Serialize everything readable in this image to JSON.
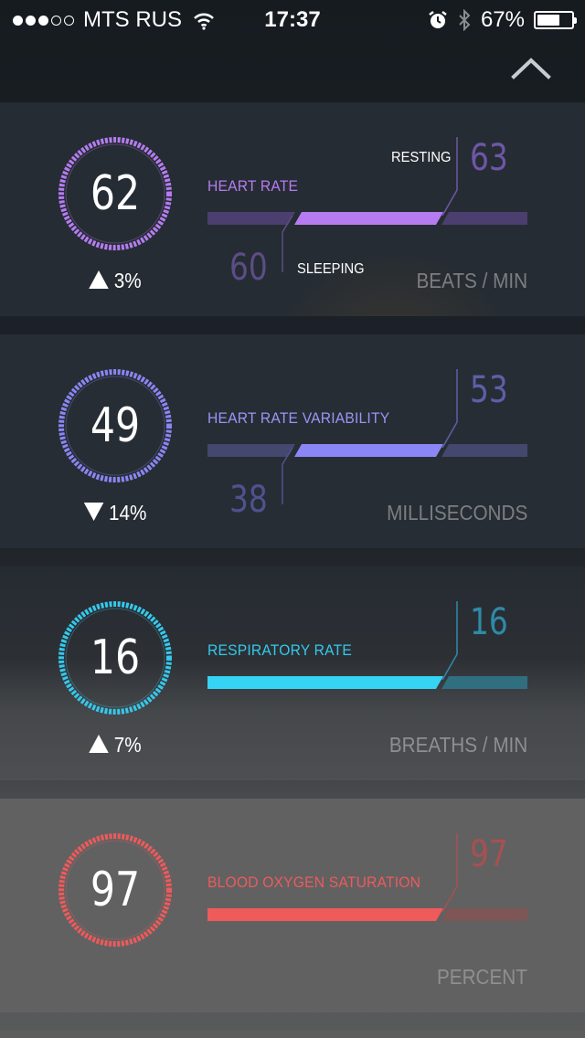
{
  "status_bar": {
    "carrier": "MTS RUS",
    "time": "17:37",
    "battery_percent_label": "67%",
    "battery_level": 0.67,
    "signal_filled": 3,
    "signal_total": 5,
    "icons": [
      "wifi-icon",
      "alarm-icon",
      "bluetooth-icon",
      "battery-icon"
    ]
  },
  "header": {
    "collapse_icon": "chevron-up-icon"
  },
  "cards": [
    {
      "id": "heart-rate",
      "value": "62",
      "change": "3%",
      "trend": "up",
      "label": "HEART RATE",
      "high_value": "63",
      "high_label": "RESTING",
      "low_value": "60",
      "low_label": "SLEEPING",
      "unit": "BEATS / MIN",
      "has_moon": false,
      "color": "#b57cf2"
    },
    {
      "id": "heart-rate-variability",
      "value": "49",
      "change": "14%",
      "trend": "down",
      "label": "HEART RATE VARIABILITY",
      "high_value": "53",
      "low_value": "38",
      "unit": "MILLISECONDS",
      "has_moon": true,
      "color": "#8a86f5"
    },
    {
      "id": "respiratory-rate",
      "value": "16",
      "change": "7%",
      "trend": "up",
      "label": "RESPIRATORY RATE",
      "high_value": "16",
      "unit": "BREATHS / MIN",
      "has_moon": true,
      "color": "#35c8ec"
    },
    {
      "id": "blood-oxygen-saturation",
      "value": "97",
      "label": "BLOOD OXYGEN SATURATION",
      "high_value": "97",
      "unit": "PERCENT",
      "has_moon": true,
      "color": "#ef5a5a"
    }
  ]
}
